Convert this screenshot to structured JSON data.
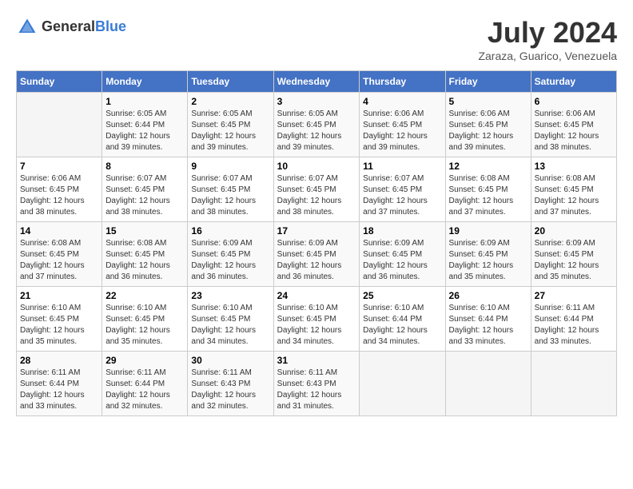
{
  "header": {
    "logo_general": "General",
    "logo_blue": "Blue",
    "month_title": "July 2024",
    "location": "Zaraza, Guarico, Venezuela"
  },
  "days_of_week": [
    "Sunday",
    "Monday",
    "Tuesday",
    "Wednesday",
    "Thursday",
    "Friday",
    "Saturday"
  ],
  "weeks": [
    [
      {
        "day": "",
        "info": ""
      },
      {
        "day": "1",
        "info": "Sunrise: 6:05 AM\nSunset: 6:44 PM\nDaylight: 12 hours\nand 39 minutes."
      },
      {
        "day": "2",
        "info": "Sunrise: 6:05 AM\nSunset: 6:45 PM\nDaylight: 12 hours\nand 39 minutes."
      },
      {
        "day": "3",
        "info": "Sunrise: 6:05 AM\nSunset: 6:45 PM\nDaylight: 12 hours\nand 39 minutes."
      },
      {
        "day": "4",
        "info": "Sunrise: 6:06 AM\nSunset: 6:45 PM\nDaylight: 12 hours\nand 39 minutes."
      },
      {
        "day": "5",
        "info": "Sunrise: 6:06 AM\nSunset: 6:45 PM\nDaylight: 12 hours\nand 39 minutes."
      },
      {
        "day": "6",
        "info": "Sunrise: 6:06 AM\nSunset: 6:45 PM\nDaylight: 12 hours\nand 38 minutes."
      }
    ],
    [
      {
        "day": "7",
        "info": "Sunrise: 6:06 AM\nSunset: 6:45 PM\nDaylight: 12 hours\nand 38 minutes."
      },
      {
        "day": "8",
        "info": "Sunrise: 6:07 AM\nSunset: 6:45 PM\nDaylight: 12 hours\nand 38 minutes."
      },
      {
        "day": "9",
        "info": "Sunrise: 6:07 AM\nSunset: 6:45 PM\nDaylight: 12 hours\nand 38 minutes."
      },
      {
        "day": "10",
        "info": "Sunrise: 6:07 AM\nSunset: 6:45 PM\nDaylight: 12 hours\nand 38 minutes."
      },
      {
        "day": "11",
        "info": "Sunrise: 6:07 AM\nSunset: 6:45 PM\nDaylight: 12 hours\nand 37 minutes."
      },
      {
        "day": "12",
        "info": "Sunrise: 6:08 AM\nSunset: 6:45 PM\nDaylight: 12 hours\nand 37 minutes."
      },
      {
        "day": "13",
        "info": "Sunrise: 6:08 AM\nSunset: 6:45 PM\nDaylight: 12 hours\nand 37 minutes."
      }
    ],
    [
      {
        "day": "14",
        "info": "Sunrise: 6:08 AM\nSunset: 6:45 PM\nDaylight: 12 hours\nand 37 minutes."
      },
      {
        "day": "15",
        "info": "Sunrise: 6:08 AM\nSunset: 6:45 PM\nDaylight: 12 hours\nand 36 minutes."
      },
      {
        "day": "16",
        "info": "Sunrise: 6:09 AM\nSunset: 6:45 PM\nDaylight: 12 hours\nand 36 minutes."
      },
      {
        "day": "17",
        "info": "Sunrise: 6:09 AM\nSunset: 6:45 PM\nDaylight: 12 hours\nand 36 minutes."
      },
      {
        "day": "18",
        "info": "Sunrise: 6:09 AM\nSunset: 6:45 PM\nDaylight: 12 hours\nand 36 minutes."
      },
      {
        "day": "19",
        "info": "Sunrise: 6:09 AM\nSunset: 6:45 PM\nDaylight: 12 hours\nand 35 minutes."
      },
      {
        "day": "20",
        "info": "Sunrise: 6:09 AM\nSunset: 6:45 PM\nDaylight: 12 hours\nand 35 minutes."
      }
    ],
    [
      {
        "day": "21",
        "info": "Sunrise: 6:10 AM\nSunset: 6:45 PM\nDaylight: 12 hours\nand 35 minutes."
      },
      {
        "day": "22",
        "info": "Sunrise: 6:10 AM\nSunset: 6:45 PM\nDaylight: 12 hours\nand 35 minutes."
      },
      {
        "day": "23",
        "info": "Sunrise: 6:10 AM\nSunset: 6:45 PM\nDaylight: 12 hours\nand 34 minutes."
      },
      {
        "day": "24",
        "info": "Sunrise: 6:10 AM\nSunset: 6:45 PM\nDaylight: 12 hours\nand 34 minutes."
      },
      {
        "day": "25",
        "info": "Sunrise: 6:10 AM\nSunset: 6:44 PM\nDaylight: 12 hours\nand 34 minutes."
      },
      {
        "day": "26",
        "info": "Sunrise: 6:10 AM\nSunset: 6:44 PM\nDaylight: 12 hours\nand 33 minutes."
      },
      {
        "day": "27",
        "info": "Sunrise: 6:11 AM\nSunset: 6:44 PM\nDaylight: 12 hours\nand 33 minutes."
      }
    ],
    [
      {
        "day": "28",
        "info": "Sunrise: 6:11 AM\nSunset: 6:44 PM\nDaylight: 12 hours\nand 33 minutes."
      },
      {
        "day": "29",
        "info": "Sunrise: 6:11 AM\nSunset: 6:44 PM\nDaylight: 12 hours\nand 32 minutes."
      },
      {
        "day": "30",
        "info": "Sunrise: 6:11 AM\nSunset: 6:43 PM\nDaylight: 12 hours\nand 32 minutes."
      },
      {
        "day": "31",
        "info": "Sunrise: 6:11 AM\nSunset: 6:43 PM\nDaylight: 12 hours\nand 31 minutes."
      },
      {
        "day": "",
        "info": ""
      },
      {
        "day": "",
        "info": ""
      },
      {
        "day": "",
        "info": ""
      }
    ]
  ]
}
